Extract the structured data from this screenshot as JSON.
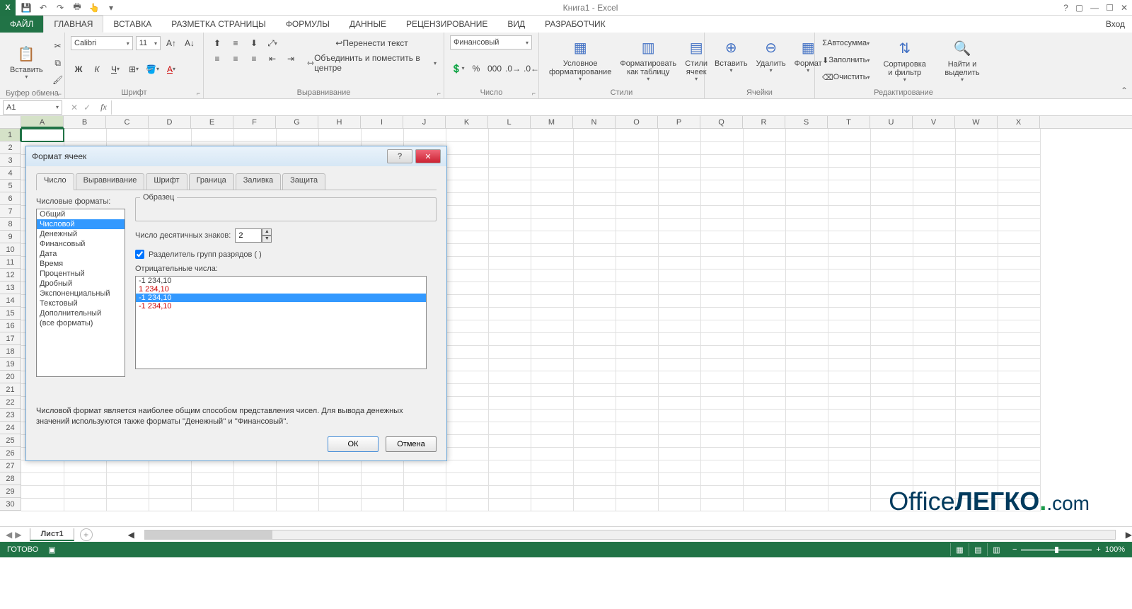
{
  "app": {
    "title": "Книга1 - Excel",
    "login": "Вход"
  },
  "qat": {
    "save": "💾",
    "undo": "↶",
    "redo": "↷",
    "print": "🖶",
    "preview": "🔍"
  },
  "tabs": {
    "file": "ФАЙЛ",
    "home": "ГЛАВНАЯ",
    "insert": "ВСТАВКА",
    "layout": "РАЗМЕТКА СТРАНИЦЫ",
    "formulas": "ФОРМУЛЫ",
    "data": "ДАННЫЕ",
    "review": "РЕЦЕНЗИРОВАНИЕ",
    "view": "ВИД",
    "developer": "РАЗРАБОТЧИК"
  },
  "ribbon": {
    "clipboard": {
      "paste": "Вставить",
      "label": "Буфер обмена"
    },
    "font": {
      "name": "Calibri",
      "size": "11",
      "label": "Шрифт"
    },
    "align": {
      "wrap": "Перенести текст",
      "merge": "Объединить и поместить в центре",
      "label": "Выравнивание"
    },
    "number": {
      "format": "Финансовый",
      "label": "Число"
    },
    "styles": {
      "cond": "Условное форматирование",
      "table": "Форматировать как таблицу",
      "cell": "Стили ячеек",
      "label": "Стили"
    },
    "cells": {
      "insert": "Вставить",
      "delete": "Удалить",
      "format": "Формат",
      "label": "Ячейки"
    },
    "editing": {
      "sum": "Автосумма",
      "fill": "Заполнить",
      "clear": "Очистить",
      "sort": "Сортировка и фильтр",
      "find": "Найти и выделить",
      "label": "Редактирование"
    }
  },
  "namebox": "A1",
  "columns": [
    "A",
    "B",
    "C",
    "D",
    "E",
    "F",
    "G",
    "H",
    "I",
    "J",
    "K",
    "L",
    "M",
    "N",
    "O",
    "P",
    "Q",
    "R",
    "S",
    "T",
    "U",
    "V",
    "W",
    "X"
  ],
  "rows": [
    1,
    2,
    3,
    4,
    5,
    6,
    7,
    8,
    9,
    10,
    11,
    12,
    13,
    14,
    15,
    16,
    17,
    18,
    19,
    20,
    21,
    22,
    23,
    24,
    25,
    26,
    27,
    28,
    29,
    30
  ],
  "dialog": {
    "title": "Формат ячеек",
    "tabs": [
      "Число",
      "Выравнивание",
      "Шрифт",
      "Граница",
      "Заливка",
      "Защита"
    ],
    "fmt_label": "Числовые форматы:",
    "formats": [
      "Общий",
      "Числовой",
      "Денежный",
      "Финансовый",
      "Дата",
      "Время",
      "Процентный",
      "Дробный",
      "Экспоненциальный",
      "Текстовый",
      "Дополнительный",
      "(все форматы)"
    ],
    "sample_label": "Образец",
    "decimals_label": "Число десятичных знаков:",
    "decimals": "2",
    "sep_label": "Разделитель групп разрядов ( )",
    "neg_label": "Отрицательные числа:",
    "neg_values": [
      "-1 234,10",
      "1 234,10",
      "-1 234,10",
      "-1 234,10"
    ],
    "desc": "Числовой формат является наиболее общим способом представления чисел. Для вывода денежных значений используются также форматы ''Денежный'' и ''Финансовый''.",
    "ok": "ОК",
    "cancel": "Отмена"
  },
  "sheet": {
    "name": "Лист1"
  },
  "status": {
    "ready": "ГОТОВО",
    "zoom": "100%"
  },
  "watermark": {
    "p1": "Office",
    "p2": "ЛЕГКО",
    "p3": ".com"
  }
}
